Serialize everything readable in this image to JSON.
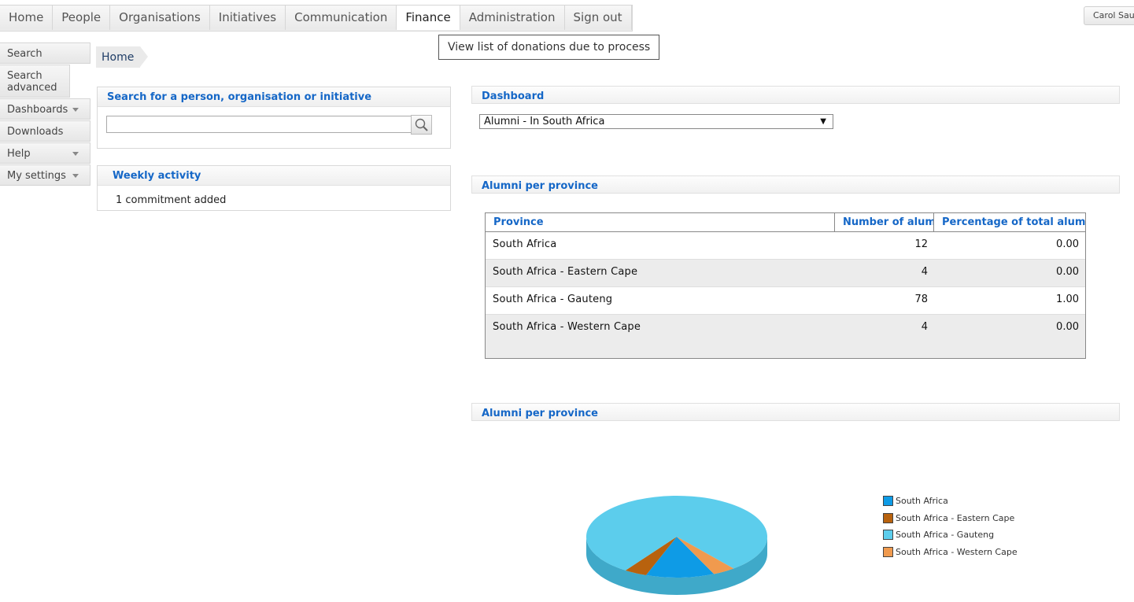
{
  "topnav": [
    {
      "label": "Home"
    },
    {
      "label": "People"
    },
    {
      "label": "Organisations"
    },
    {
      "label": "Initiatives"
    },
    {
      "label": "Communication"
    },
    {
      "label": "Finance"
    },
    {
      "label": "Administration"
    },
    {
      "label": "Sign out"
    }
  ],
  "active_nav": "Finance",
  "user_button": "Carol Sau",
  "tooltip": "View list of donations due to process",
  "sidebar": {
    "items": [
      {
        "label": "Search"
      },
      {
        "label": "Search advanced"
      },
      {
        "label": "Dashboards"
      },
      {
        "label": "Downloads"
      },
      {
        "label": "Help"
      },
      {
        "label": "My settings"
      }
    ]
  },
  "breadcrumb": {
    "home": "Home"
  },
  "search_panel": {
    "title": "Search for a person, organisation or initiative",
    "value": ""
  },
  "activity_panel": {
    "title": "Weekly activity",
    "text": "1 commitment added"
  },
  "dashboard": {
    "title": "Dashboard",
    "selected": "Alumni - In South Africa"
  },
  "table_section": {
    "title": "Alumni per province"
  },
  "table": {
    "columns": [
      "Province",
      "Number of alumni",
      "Percentage of total alumni"
    ],
    "rows": [
      [
        "South Africa",
        "12",
        "0.00"
      ],
      [
        "South Africa - Eastern Cape",
        "4",
        "0.00"
      ],
      [
        "South Africa - Gauteng",
        "78",
        "1.00"
      ],
      [
        "South Africa - Western Cape",
        "4",
        "0.00"
      ]
    ]
  },
  "chart_section": {
    "title": "Alumni per province"
  },
  "chart_data": {
    "type": "pie",
    "categories": [
      "South Africa",
      "South Africa - Eastern Cape",
      "South Africa - Gauteng",
      "South Africa - Western Cape"
    ],
    "values": [
      12,
      4,
      78,
      4
    ],
    "colors": [
      "#0e9be6",
      "#b8620e",
      "#5ccdec",
      "#f09a4e"
    ],
    "legend": "right"
  }
}
